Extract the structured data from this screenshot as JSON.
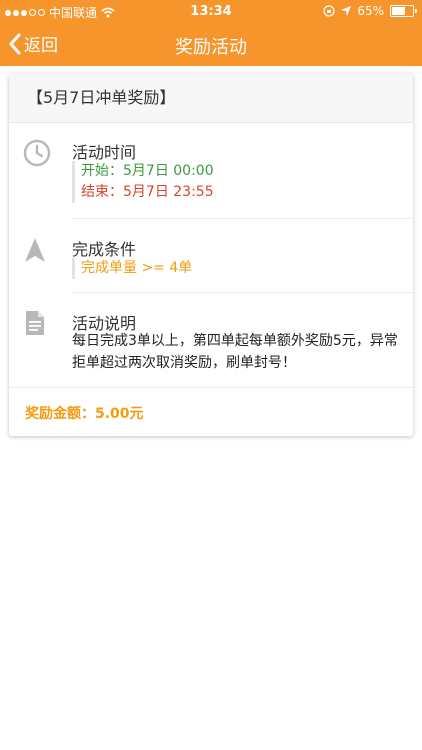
{
  "status_bar": {
    "carrier": "中国联通",
    "time": "13:34",
    "battery": "65%",
    "battery_level": 0.65
  },
  "nav": {
    "back_label": "返回",
    "title": "奖励活动"
  },
  "card": {
    "title": "【5月7日冲单奖励】",
    "time_section": {
      "label": "活动时间",
      "start": "开始：5月7日 00:00",
      "end": "结束：5月7日 23:55"
    },
    "condition_section": {
      "label": "完成条件",
      "value": "完成单量 >= 4单"
    },
    "desc_section": {
      "label": "活动说明",
      "text": "每日完成3单以上，第四单起每单额外奖励5元，异常拒单超过两次取消奖励，刷单封号！"
    },
    "reward": "奖励金额：5.00元"
  },
  "colors": {
    "brand": "#f7952d",
    "start_green": "#3c9a3f",
    "end_red": "#d9432f",
    "accent_orange": "#f39c12"
  },
  "icons": [
    "signal-icon",
    "wifi-icon",
    "lock-rotation-icon",
    "location-arrow-icon",
    "battery-icon",
    "chevron-left-icon",
    "clock-icon",
    "navigation-arrow-icon",
    "document-icon"
  ]
}
